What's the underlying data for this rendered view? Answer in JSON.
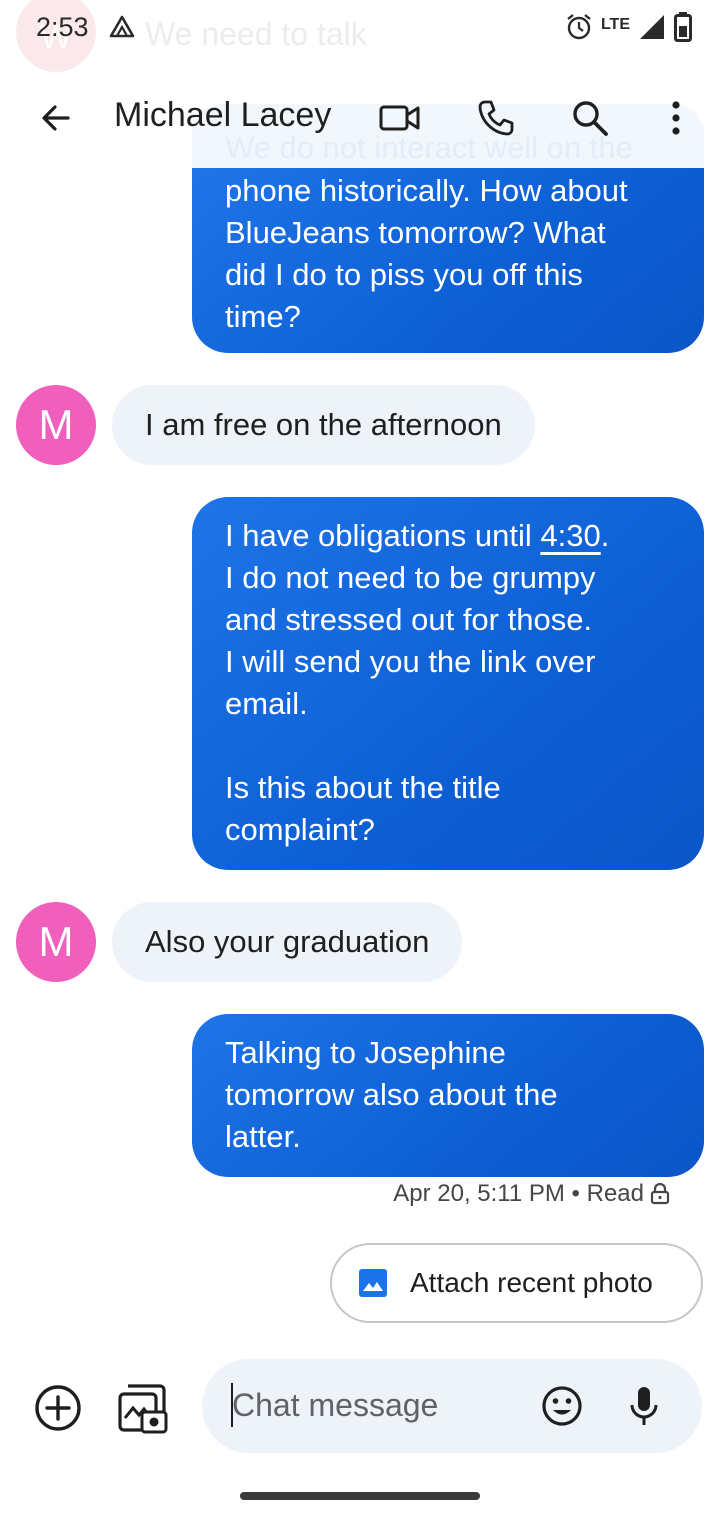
{
  "status_bar": {
    "time": "2:53",
    "notification_avatar_letter": "W",
    "notification_text": "We need to talk",
    "network": "LTE"
  },
  "app_bar": {
    "contact_name": "Michael Lacey"
  },
  "conversation": {
    "faded_top_text": "We do not interact well on the",
    "message_1_lines": [
      "phone historically. How about",
      "BlueJeans tomorrow? What",
      "did I do to piss you off this",
      "time?"
    ],
    "message_2": "I am free on the afternoon",
    "message_3": {
      "line1_prefix": "I have obligations until ",
      "line1_link": "4:30",
      "line1_suffix": ".",
      "lines": [
        "I do not need to be grumpy",
        "and stressed out for those.",
        "I will send you the link over",
        "email.",
        "",
        "Is this about the title",
        "complaint?"
      ]
    },
    "message_4": "Also your graduation",
    "message_5_lines": [
      "Talking to Josephine",
      "tomorrow also about the",
      "latter."
    ],
    "avatar_letter": "M",
    "meta": "Apr 20, 5:11 PM • Read"
  },
  "suggestion": {
    "label": "Attach recent photo"
  },
  "compose": {
    "placeholder": "Chat message"
  },
  "colors": {
    "outgoing_bubble": "#1a6ce0",
    "incoming_bubble": "#eef2f9",
    "avatar": "#f05fbb"
  }
}
